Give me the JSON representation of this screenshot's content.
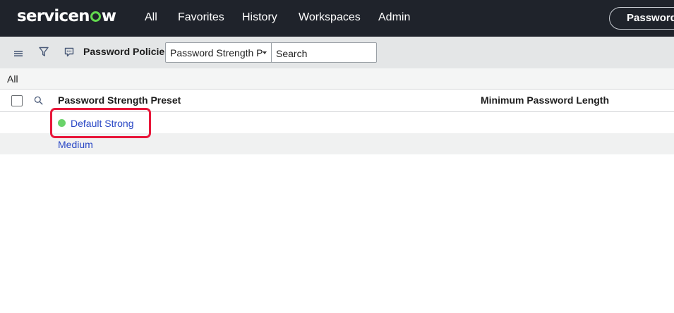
{
  "topnav": {
    "logo_text_before": "servicen",
    "logo_text_after": "w",
    "items": [
      "All",
      "Favorites",
      "History",
      "Workspaces",
      "Admin"
    ],
    "pill_label": "Password"
  },
  "toolbar": {
    "list_title": "Password Policies",
    "field_select_value": "Password Strength P",
    "search_placeholder": "Search"
  },
  "breadcrumb": {
    "label": "All"
  },
  "table": {
    "columns": [
      "Password Strength Preset",
      "Minimum Password Length"
    ],
    "rows": [
      {
        "preset": "Default Strong",
        "min_length": "",
        "status_dot_color": "#6ad36a"
      },
      {
        "preset": "Medium",
        "min_length": ""
      }
    ]
  },
  "colors": {
    "nav_background": "#1f232b",
    "logo_accent": "#62d84e",
    "link": "#2947c5",
    "highlight": "#e8173a"
  },
  "icons": [
    "hamburger-menu-icon",
    "filter-icon",
    "chat-bubble-icon",
    "caret-down-icon",
    "search-icon"
  ]
}
